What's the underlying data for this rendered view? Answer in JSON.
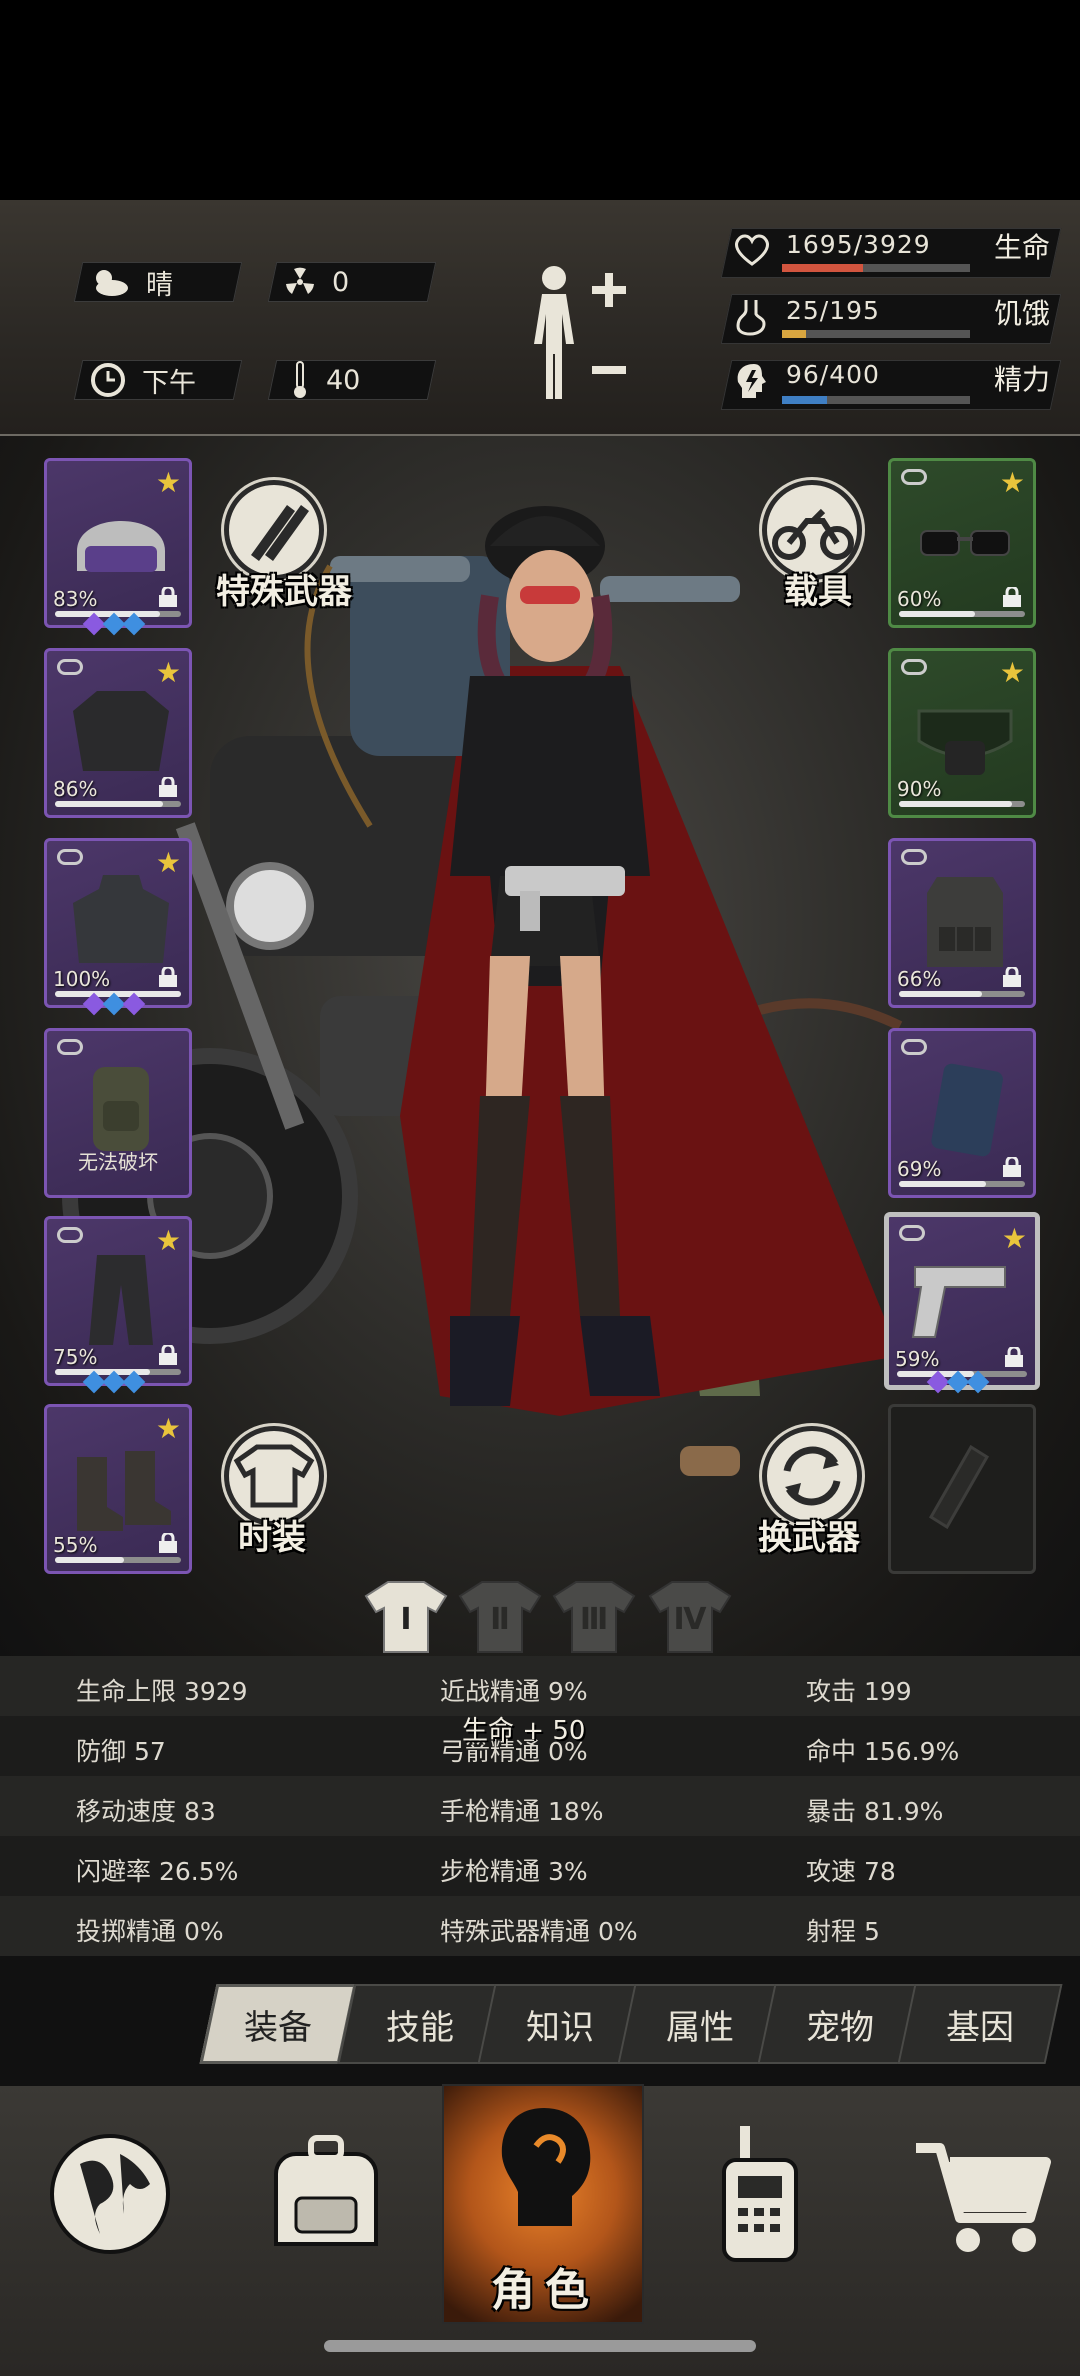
{
  "status": {
    "weather": "晴",
    "radiation": "0",
    "time_of_day": "下午",
    "temperature": "40",
    "health": {
      "text": "1695/3929",
      "label": "生命",
      "current": 1695,
      "max": 3929,
      "color": "#d2553f"
    },
    "hunger": {
      "text": "25/195",
      "label": "饥饿",
      "current": 25,
      "max": 195,
      "color": "#d9a640"
    },
    "energy": {
      "text": "96/400",
      "label": "精力",
      "current": 96,
      "max": 400,
      "color": "#3f7fc4"
    }
  },
  "scene": {
    "special_weapon_label": "特殊武器",
    "vehicle_label": "载具",
    "fashion_label": "时装",
    "swap_weapon_label": "换武器"
  },
  "left_slots": [
    {
      "item": "police-helmet",
      "durability": "83%",
      "durability_value": 0.83,
      "starred": true,
      "locked": true,
      "gems": [
        "#8a5ae0",
        "#3f8fe0",
        "#3f8fe0"
      ]
    },
    {
      "item": "jacket",
      "durability": "86%",
      "durability_value": 0.86,
      "starred": true,
      "locked": true,
      "gems": []
    },
    {
      "item": "hooded-jacket",
      "durability": "100%",
      "durability_value": 1.0,
      "starred": true,
      "locked": true,
      "gems": [
        "#8a5ae0",
        "#3f8fe0",
        "#8a5ae0"
      ]
    },
    {
      "item": "backpack",
      "durability": "",
      "note": "无法破坏",
      "starred": false,
      "locked": false,
      "gems": []
    },
    {
      "item": "cargo-pants",
      "durability": "75%",
      "durability_value": 0.75,
      "starred": true,
      "locked": true,
      "gems": [
        "#3f8fe0",
        "#3f8fe0",
        "#3f8fe0"
      ]
    },
    {
      "item": "boots",
      "durability": "55%",
      "durability_value": 0.55,
      "starred": true,
      "locked": true,
      "gems": []
    }
  ],
  "right_slots": [
    {
      "item": "sunglasses",
      "durability": "60%",
      "durability_value": 0.6,
      "rarity": "green",
      "starred": true,
      "locked": true
    },
    {
      "item": "goggles",
      "durability": "90%",
      "durability_value": 0.9,
      "rarity": "green",
      "starred": true,
      "locked": false
    },
    {
      "item": "tactical-vest",
      "durability": "66%",
      "durability_value": 0.66,
      "rarity": "purple",
      "starred": false,
      "locked": true
    },
    {
      "item": "shield-pouch",
      "durability": "69%",
      "durability_value": 0.69,
      "rarity": "purple",
      "starred": false,
      "locked": true
    },
    {
      "item": "desert-eagle-pistol",
      "durability": "59%",
      "durability_value": 0.59,
      "rarity": "purple",
      "starred": true,
      "locked": true,
      "selected": true,
      "gems": [
        "#8a5ae0",
        "#3f8fe0",
        "#3f8fe0"
      ]
    },
    {
      "item": "empty-bottle-slot",
      "durability": "",
      "rarity": "empty"
    }
  ],
  "outfits": [
    "Ⅰ",
    "Ⅱ",
    "Ⅲ",
    "Ⅳ"
  ],
  "active_outfit": 0,
  "stats": {
    "rows": [
      [
        "生命上限 3929",
        "近战精通 9%",
        "攻击 199"
      ],
      [
        "防御 57",
        "弓箭精通 0%",
        "命中 156.9%"
      ],
      [
        "移动速度 83",
        "手枪精通 18%",
        "暴击 81.9%"
      ],
      [
        "闪避率 26.5%",
        "步枪精通 3%",
        "攻速 78"
      ],
      [
        "投掷精通 0%",
        "特殊武器精通 0%",
        "射程 5"
      ]
    ],
    "bonus_popup": "生命 + 50"
  },
  "tabs": [
    "装备",
    "技能",
    "知识",
    "属性",
    "宠物",
    "基因"
  ],
  "active_tab": 0,
  "nav": {
    "character_label": "角色",
    "items": [
      "world-map",
      "inventory",
      "character",
      "radio",
      "shop"
    ]
  }
}
